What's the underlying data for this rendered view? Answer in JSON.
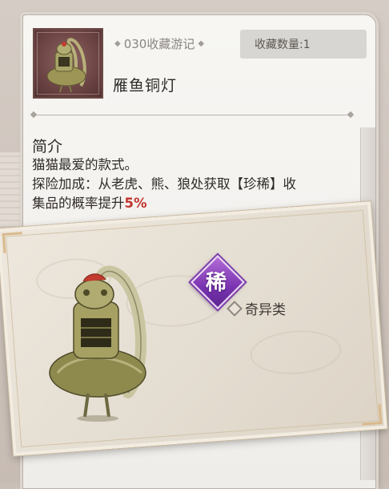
{
  "header": {
    "collection_id": "030收藏游记",
    "collection_count": "收藏数量:1"
  },
  "item": {
    "name": "雁鱼铜灯",
    "thumbnail_icon": "goose-fish-bronze-lamp-icon"
  },
  "intro": {
    "title": "简介",
    "line1": "猫猫最爱的款式。",
    "line2": "探险加成：从老虎、熊、狼处获取【珍稀】收",
    "line3_prefix": "集品的概率提升",
    "line3_value": "5%"
  },
  "detail": {
    "rarity_label": "稀",
    "category": "奇异类",
    "illustration_icon": "goose-fish-bronze-lamp-icon"
  },
  "colors": {
    "rarity_purple": "#7a34b0",
    "highlight_red": "#c0342c",
    "thumb_bg": "#6c4444"
  }
}
